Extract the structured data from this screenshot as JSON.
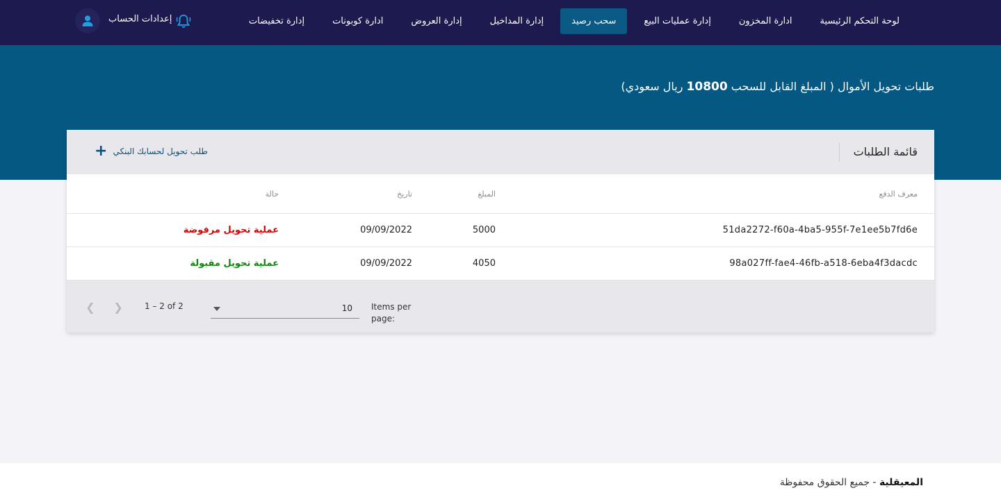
{
  "nav": {
    "items": [
      {
        "label": "لوحة التحكم الرئيسية",
        "active": false
      },
      {
        "label": "ادارة المخزون",
        "active": false
      },
      {
        "label": "إدارة عمليات البيع",
        "active": false
      },
      {
        "label": "سحب رصيد",
        "active": true
      },
      {
        "label": "إدارة المداخيل",
        "active": false
      },
      {
        "label": "إدارة العروض",
        "active": false
      },
      {
        "label": "ادارة كوبونات",
        "active": false
      },
      {
        "label": "إدارة تخفيضات",
        "active": false
      }
    ],
    "account_label": "إعدادات الحساب",
    "bell_icon": "bell-icon",
    "avatar_icon": "person-icon"
  },
  "headline": {
    "prefix": "طلبات تحويل الأموال ( المبلغ القابل للسحب",
    "amount": "10800",
    "suffix": "ريال سعودي)"
  },
  "card": {
    "title": "قائمة الطلبات",
    "add_request_label": "طلب تحويل لحسابك البنكي",
    "columns": {
      "id": "معرف الدفع",
      "amount": "المبلغ",
      "date": "تاريخ",
      "status": "حالة"
    },
    "rows": [
      {
        "id": "51da2272-f60a-4ba5-955f-7e1ee5b7fd6e",
        "amount": "5000",
        "date": "09/09/2022",
        "status": "عملية تحويل مرفوضة",
        "status_color": "#e00000"
      },
      {
        "id": "98a027ff-fae4-46fb-a518-6eba4f3dacdc",
        "amount": "4050",
        "date": "09/09/2022",
        "status": "عملية تحويل مقبولة",
        "status_color": "#0b8a0b"
      }
    ]
  },
  "paginator": {
    "items_per_page_label": "Items per page:",
    "page_size": "10",
    "range_label": "1 – 2 of 2"
  },
  "footer": {
    "brand": "المعيقلية",
    "text": " - جميع الحقوق محفوظة"
  }
}
